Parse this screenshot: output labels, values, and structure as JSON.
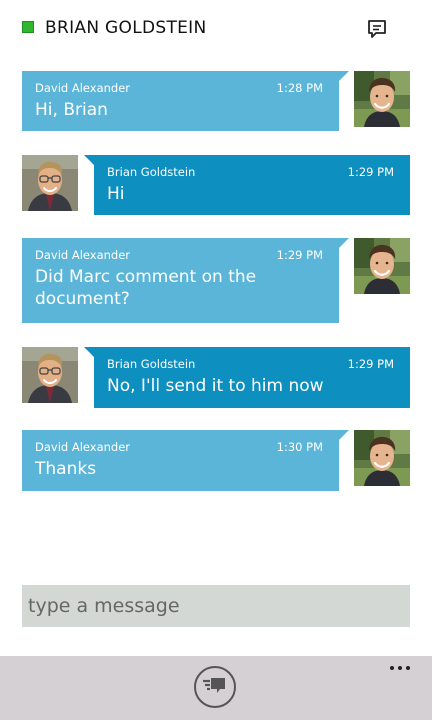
{
  "header": {
    "contact_name": "BRIAN GOLDSTEIN",
    "presence_status": "available",
    "presence_color": "#2fb82f",
    "action_icon": "chat-bubble-icon"
  },
  "messages": [
    {
      "sender": "David Alexander",
      "time": "1:28 PM",
      "text": "Hi, Brian",
      "direction": "incoming"
    },
    {
      "sender": "Brian Goldstein",
      "time": "1:29 PM",
      "text": "Hi",
      "direction": "outgoing"
    },
    {
      "sender": "David Alexander",
      "time": "1:29 PM",
      "text": "Did Marc comment on the document?",
      "direction": "incoming"
    },
    {
      "sender": "Brian Goldstein",
      "time": "1:29 PM",
      "text": "No, I'll send it to him now",
      "direction": "outgoing"
    },
    {
      "sender": "David Alexander",
      "time": "1:30 PM",
      "text": "Thanks",
      "direction": "incoming"
    }
  ],
  "composer": {
    "placeholder": "type a message",
    "value": ""
  },
  "app_bar": {
    "send_icon": "send-message-icon",
    "more_icon": "ellipsis-icon"
  },
  "colors": {
    "incoming_bubble": "#5bb5d8",
    "outgoing_bubble": "#0d8fbf",
    "input_background": "#d4d8d4",
    "app_bar_background": "#d4d0d4"
  }
}
